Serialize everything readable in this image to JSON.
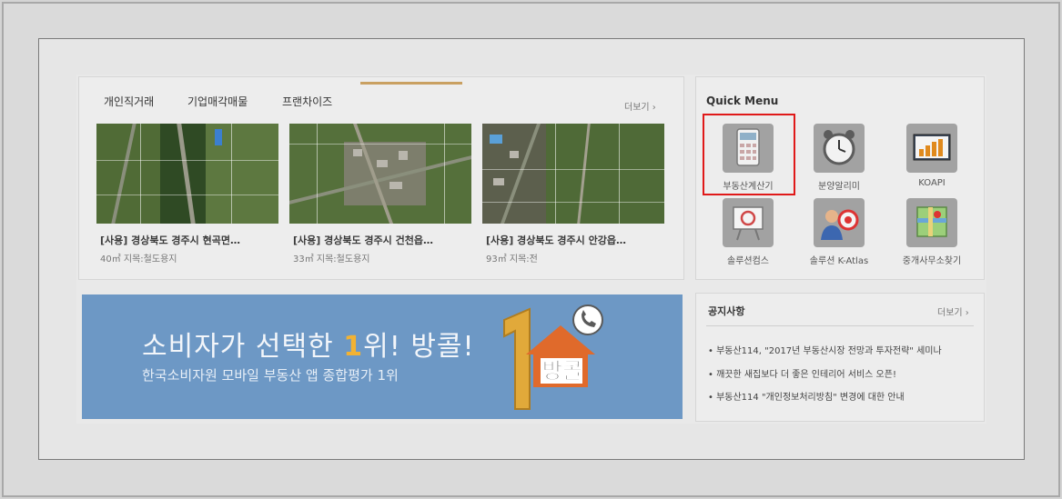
{
  "listings": {
    "tabs": [
      "개인직거래",
      "기업매각매물",
      "프랜차이즈"
    ],
    "more_label": "더보기 ›",
    "cards": [
      {
        "title": "[사용] 경상북도 경주시 현곡면…",
        "meta": "40㎡ 지목:철도용지"
      },
      {
        "title": "[사용] 경상북도 경주시 건천읍…",
        "meta": "33㎡ 지목:철도용지"
      },
      {
        "title": "[사용] 경상북도 경주시 안강읍…",
        "meta": "93㎡ 지목:전"
      }
    ]
  },
  "banner": {
    "title_pre": "소비자가 선택한 ",
    "title_num": "1",
    "title_post": "위! 방콜!",
    "subtitle": "한국소비자원 모바일 부동산 앱 종합평가 1위",
    "logo_text": "방콜",
    "accent_color": "#f2b233"
  },
  "quick_menu": {
    "title": "Quick Menu",
    "items": [
      {
        "label": "부동산계산기",
        "icon": "calculator-icon"
      },
      {
        "label": "분양알리미",
        "icon": "alarm-clock-icon"
      },
      {
        "label": "KOAPI",
        "icon": "bar-chart-icon"
      },
      {
        "label": "솔루션컴스",
        "icon": "presentation-icon"
      },
      {
        "label": "솔루션 K-Atlas",
        "icon": "target-person-icon"
      },
      {
        "label": "중개사무소찾기",
        "icon": "map-icon"
      }
    ],
    "highlight_color": "#e01919"
  },
  "notice": {
    "title": "공지사항",
    "more_label": "더보기 ›",
    "items": [
      "• 부동산114, \"2017년 부동산시장 전망과 투자전략\" 세미나",
      "• 깨끗한 새집보다 더 좋은 인테리어 서비스 오픈!",
      "• 부동산114 \"개인정보처리방침\" 변경에 대한 안내"
    ]
  }
}
